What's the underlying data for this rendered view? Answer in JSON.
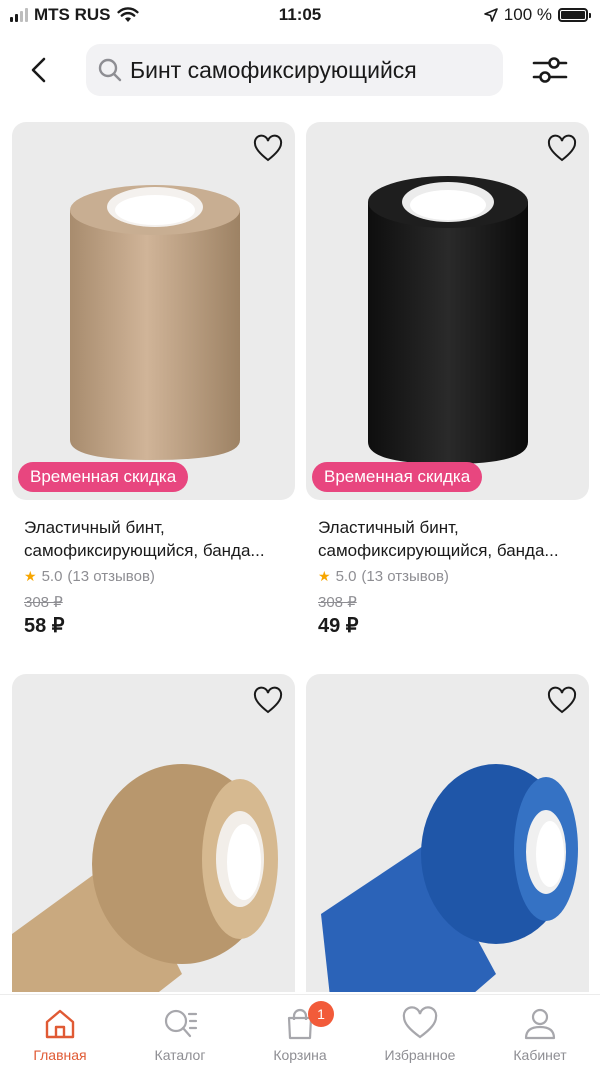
{
  "status_bar": {
    "carrier": "MTS RUS",
    "time": "11:05",
    "battery": "100 %"
  },
  "search": {
    "value": "Бинт самофиксирующийся"
  },
  "products": [
    {
      "title_line1": "Эластичный бинт,",
      "title_line2": "самофиксирующийся, банда...",
      "badge": "Временная скидка",
      "rating": "5.0",
      "reviews": "(13 отзывов)",
      "old_price": "308 ₽",
      "price": "58 ₽",
      "color": "#c7a888"
    },
    {
      "title_line1": "Эластичный бинт,",
      "title_line2": "самофиксирующийся, банда...",
      "badge": "Временная скидка",
      "rating": "5.0",
      "reviews": "(13 отзывов)",
      "old_price": "308 ₽",
      "price": "49 ₽",
      "color": "#1c1c1c"
    },
    {
      "color": "#d2b48c"
    },
    {
      "color": "#1f5fb4"
    }
  ],
  "tabs": [
    {
      "label": "Главная",
      "icon": "home-icon",
      "active": true
    },
    {
      "label": "Каталог",
      "icon": "catalog-search-icon"
    },
    {
      "label": "Корзина",
      "icon": "shopping-bag-icon",
      "badge": "1"
    },
    {
      "label": "Избранное",
      "icon": "heart-icon"
    },
    {
      "label": "Кабинет",
      "icon": "profile-icon"
    }
  ],
  "colors": {
    "accent": "#e05a34",
    "badge": "#e8467f",
    "star": "#f7a600",
    "cart_badge": "#f25b3a"
  }
}
